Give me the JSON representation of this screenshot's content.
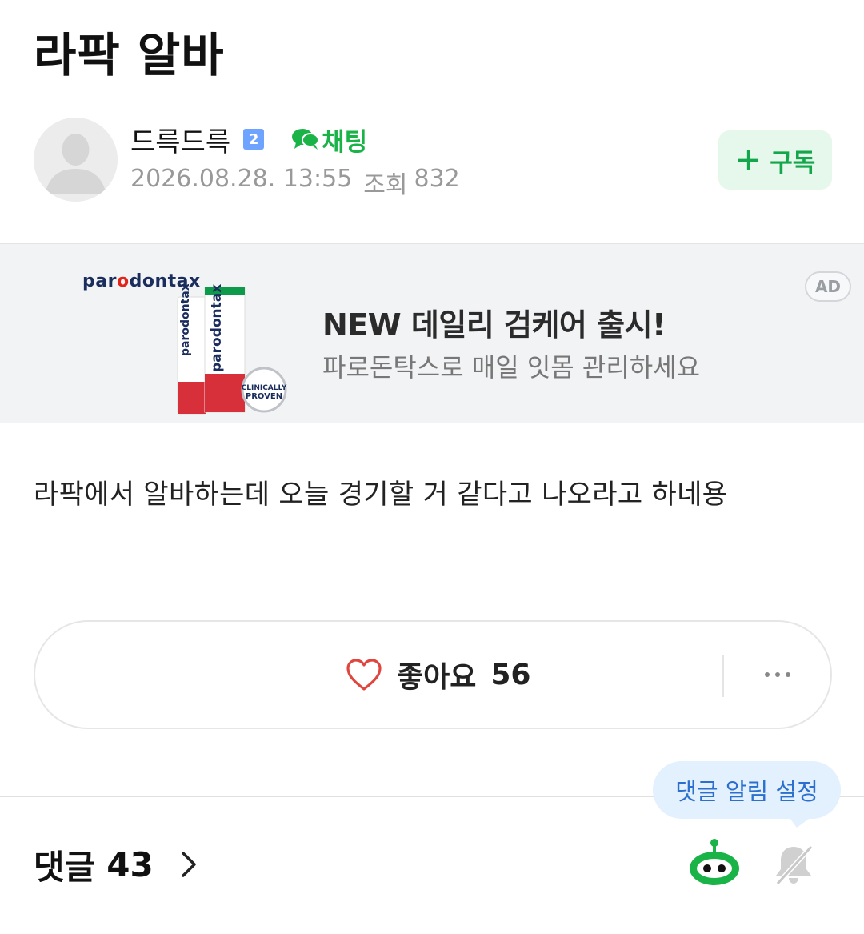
{
  "post": {
    "title": "라팍 알바",
    "body": "라팍에서 알바하는데 오늘 경기할 거 같다고 나오라고 하네용"
  },
  "author": {
    "name": "드륵드륵",
    "level": "2",
    "chat_label": "채팅",
    "date": "2026.08.28. 13:55",
    "views_label": "조회",
    "views": "832"
  },
  "subscribe": {
    "label": "구독",
    "icon": "plus-icon"
  },
  "ad": {
    "brand": "parodontax",
    "brand_prefix": "par",
    "brand_o": "o",
    "brand_suffix": "dontax",
    "headline": "NEW 데일리 검케어 출시!",
    "sub": "파로돈탁스로 매일 잇몸 관리하세요",
    "tag": "AD",
    "badge_line1": "CLINICALLY",
    "badge_line2": "PROVEN"
  },
  "reactions": {
    "like_label": "좋아요",
    "like_count": "56",
    "like_icon": "heart-icon",
    "more_icon": "more-dots-icon"
  },
  "comments": {
    "label": "댓글",
    "count": "43",
    "notify_tooltip": "댓글 알림 설정",
    "icons": [
      "chevron-right-icon",
      "bot-icon",
      "bell-off-icon"
    ]
  },
  "colors": {
    "accent_green": "#19b347",
    "subscribe_bg": "#e6f7ec",
    "tooltip_bg": "#e3f0fd",
    "tooltip_text": "#2b6fcf",
    "like_heart": "#e0453e"
  }
}
